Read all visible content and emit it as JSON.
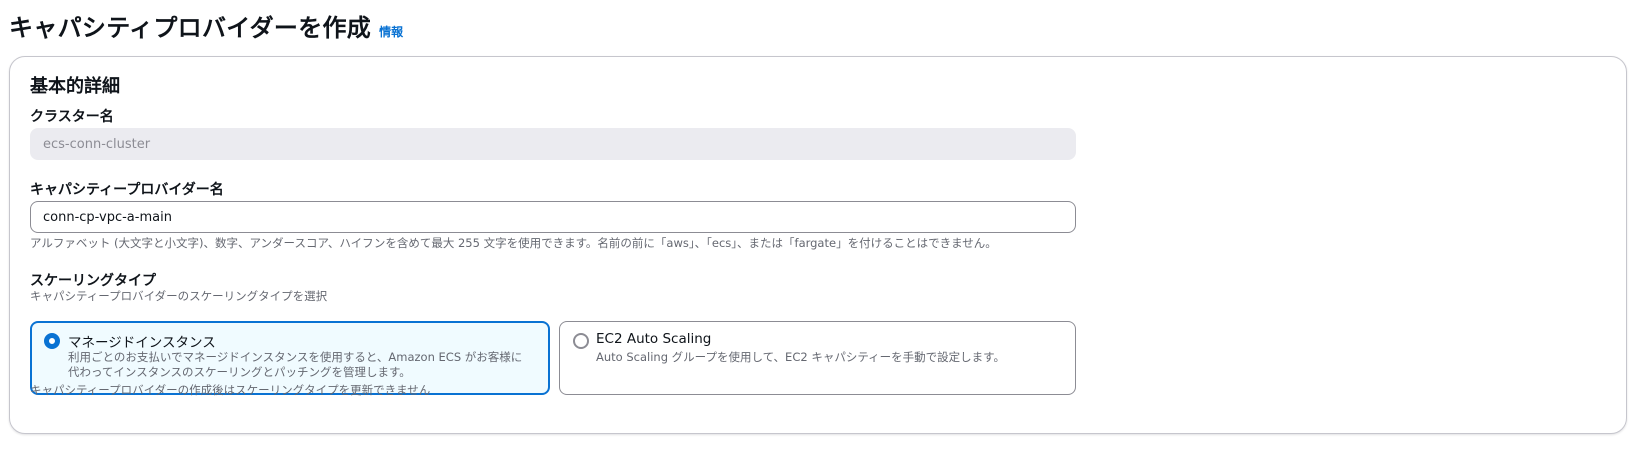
{
  "header": {
    "title": "キャパシティプロバイダーを作成",
    "info_link": "情報"
  },
  "basic_details": {
    "section_title": "基本的詳細",
    "cluster_name": {
      "label": "クラスター名",
      "value": "ecs-conn-cluster",
      "disabled": true
    },
    "capacity_provider_name": {
      "label": "キャパシティープロバイダー名",
      "value": "conn-cp-vpc-a-main",
      "constraint": "アルファベット (大文字と小文字)、数字、アンダースコア、ハイフンを含めて最大 255 文字を使用できます。名前の前に「aws」、「ecs」、または「fargate」を付けることはできません。"
    },
    "scaling_type": {
      "label": "スケーリングタイプ",
      "description": "キャパシティープロバイダーのスケーリングタイプを選択",
      "options": [
        {
          "title": "マネージドインスタンス",
          "description": "利用ごとのお支払いでマネージドインスタンスを使用すると、Amazon ECS がお客様に代わってインスタンスのスケーリングとパッチングを管理します。",
          "selected": true
        },
        {
          "title": "EC2 Auto Scaling",
          "description": "Auto Scaling グループを使用して、EC2 キャパシティーを手動で設定します。",
          "selected": false
        }
      ],
      "constraint": "キャパシティープロバイダーの作成後はスケーリングタイプを更新できません"
    }
  },
  "colors": {
    "accent": "#0972d3",
    "selected_tile_bg": "#f0fbff",
    "disabled_input_bg": "#ebebf0",
    "secondary_text": "#656871"
  },
  "icons": {
    "radio_selected": "radio-selected-icon",
    "radio_unselected": "radio-unselected-icon"
  }
}
